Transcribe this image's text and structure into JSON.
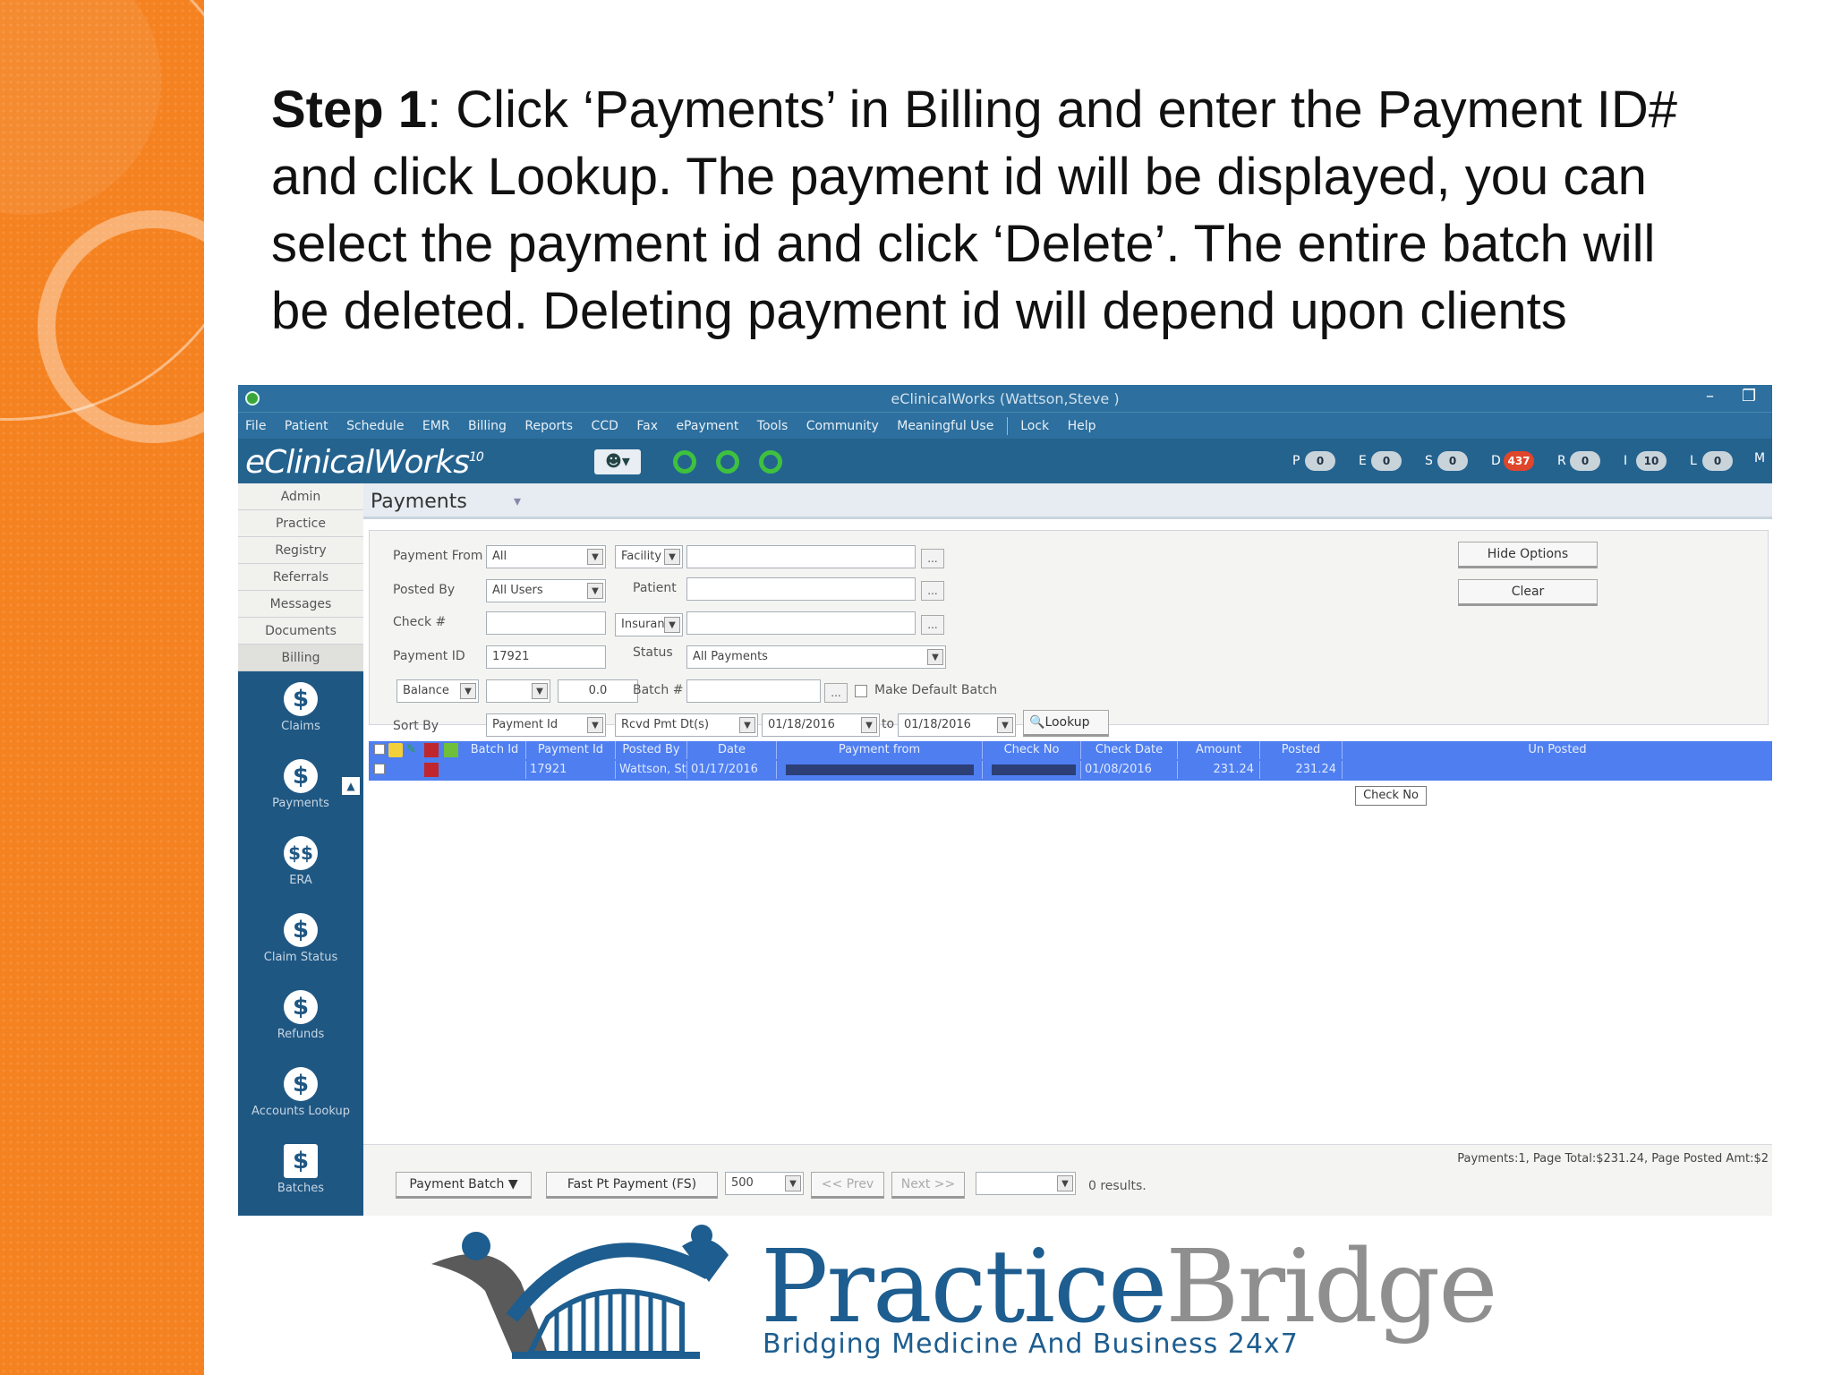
{
  "instruction": {
    "bold": "Step 1",
    "text": ": Click ‘Payments’ in Billing and enter the Payment ID# and click Lookup. The payment id will be displayed, you can select the payment id and click ‘Delete’. The entire batch will be deleted. Deleting payment id will depend upon clients"
  },
  "window": {
    "title": "eClinicalWorks (Wattson,Steve )",
    "minimize": "–",
    "restore": "❐"
  },
  "menu": [
    "File",
    "Patient",
    "Schedule",
    "EMR",
    "Billing",
    "Reports",
    "CCD",
    "Fax",
    "ePayment",
    "Tools",
    "Community",
    "Meaningful Use",
    "Lock",
    "Help"
  ],
  "brand": {
    "name": "eClinicalWorks",
    "version": "10"
  },
  "counters": [
    {
      "letter": "P",
      "value": "0"
    },
    {
      "letter": "E",
      "value": "0"
    },
    {
      "letter": "S",
      "value": "0"
    },
    {
      "letter": "D",
      "value": "437",
      "alert": true
    },
    {
      "letter": "R",
      "value": "0"
    },
    {
      "letter": "I",
      "value": "10"
    },
    {
      "letter": "L",
      "value": "0"
    },
    {
      "letter": "M",
      "value": ""
    }
  ],
  "nav_tabs": [
    "Admin",
    "Practice",
    "Registry",
    "Referrals",
    "Messages",
    "Documents",
    "Billing"
  ],
  "nav_buttons": [
    {
      "label": "Claims",
      "glyph": "$"
    },
    {
      "label": "Payments",
      "glyph": "$"
    },
    {
      "label": "ERA",
      "glyph": "$$"
    },
    {
      "label": "Claim Status",
      "glyph": "$"
    },
    {
      "label": "Refunds",
      "glyph": "$"
    },
    {
      "label": "Accounts Lookup",
      "glyph": "$"
    },
    {
      "label": "Batches",
      "glyph": "$"
    }
  ],
  "payments": {
    "title": "Payments",
    "labels": {
      "payment_from": "Payment From",
      "posted_by": "Posted By",
      "check": "Check #",
      "payment_id": "Payment ID",
      "patient": "Patient",
      "status": "Status",
      "batch": "Batch #",
      "sort_by": "Sort By",
      "make_default": "Make Default Batch",
      "to": "to"
    },
    "values": {
      "payment_from": "All",
      "facility": "Facility",
      "posted_by": "All Users",
      "insurance": "Insuranc",
      "payment_id": "17921",
      "status": "All Payments",
      "balance": "Balance",
      "balance_amount": "0.0",
      "sort_by": "Payment Id",
      "sort_field": "Rcvd Pmt Dt(s)",
      "date_from": "01/18/2016",
      "date_to": "01/18/2016"
    },
    "buttons": {
      "hide_options": "Hide Options",
      "clear": "Clear",
      "lookup": "Lookup",
      "ellipsis": "..."
    }
  },
  "grid": {
    "columns": [
      "Batch Id",
      "Payment Id",
      "Posted By",
      "Date",
      "Payment from",
      "Check No",
      "Check Date",
      "Amount",
      "Posted",
      "Un Posted"
    ],
    "row": {
      "payment_id": "17921",
      "posted_by": "Wattson, Ste",
      "date": "01/17/2016",
      "check_date": "01/08/2016",
      "amount": "231.24",
      "posted": "231.24"
    },
    "tooltip": "Check No"
  },
  "footer": {
    "summary": "Payments:1, Page Total:$231.24, Page Posted Amt:$2",
    "payment_batch": "Payment Batch",
    "fast_pt_payment": "Fast Pt Payment (FS)",
    "page_size": "500",
    "prev": "<< Prev",
    "next": "Next >>",
    "results": "0 results."
  },
  "logo": {
    "name_a": "Practice",
    "name_b": "Bridge",
    "tagline": "Bridging Medicine And Business 24x7"
  }
}
